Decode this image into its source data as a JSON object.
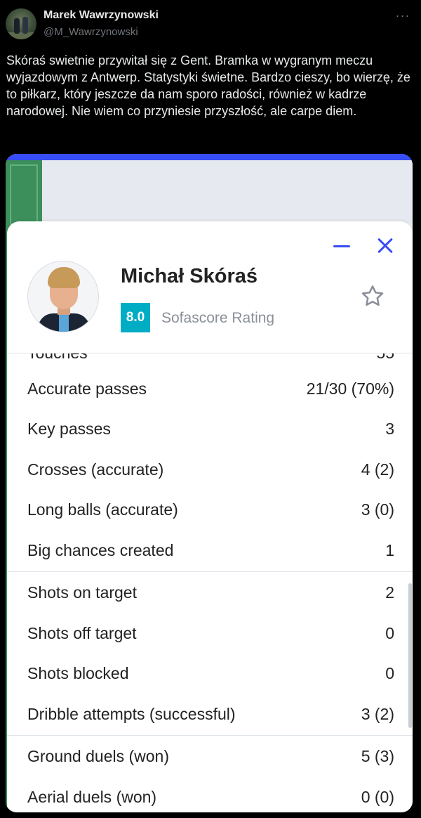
{
  "tweet": {
    "author_name": "Marek Wawrzynowski",
    "author_handle": "@M_Wawrzynowski",
    "more_icon": "more-dots-icon",
    "text": "Skóraś swietnie przywitał się z Gent. Bramka w wygranym meczu wyjazdowym z Antwerp. Statystyki świetne. Bardzo cieszy, bo wierzę, że to piłkarz, który jeszcze da nam sporo radości, również w kadrze narodowej. Nie wiem co przyniesie przyszłość, ale carpe diem."
  },
  "player_card": {
    "name": "Michał Skóraś",
    "rating": "8.0",
    "rating_label": "Sofascore Rating",
    "rating_color": "#00adc4",
    "accent_color": "#374df5",
    "icons": [
      "minimize-icon",
      "close-icon",
      "star-icon"
    ]
  },
  "stats": {
    "group1": [
      {
        "label": "Accurate passes",
        "value": "21/30 (70%)"
      },
      {
        "label": "Key passes",
        "value": "3"
      },
      {
        "label": "Crosses (accurate)",
        "value": "4 (2)"
      },
      {
        "label": "Long balls (accurate)",
        "value": "3 (0)"
      },
      {
        "label": "Big chances created",
        "value": "1"
      }
    ],
    "group2": [
      {
        "label": "Shots on target",
        "value": "2"
      },
      {
        "label": "Shots off target",
        "value": "0"
      },
      {
        "label": "Shots blocked",
        "value": "0"
      },
      {
        "label": "Dribble attempts (successful)",
        "value": "3 (2)"
      }
    ],
    "group3": [
      {
        "label": "Ground duels (won)",
        "value": "5 (3)"
      },
      {
        "label": "Aerial duels (won)",
        "value": "0 (0)"
      }
    ]
  }
}
